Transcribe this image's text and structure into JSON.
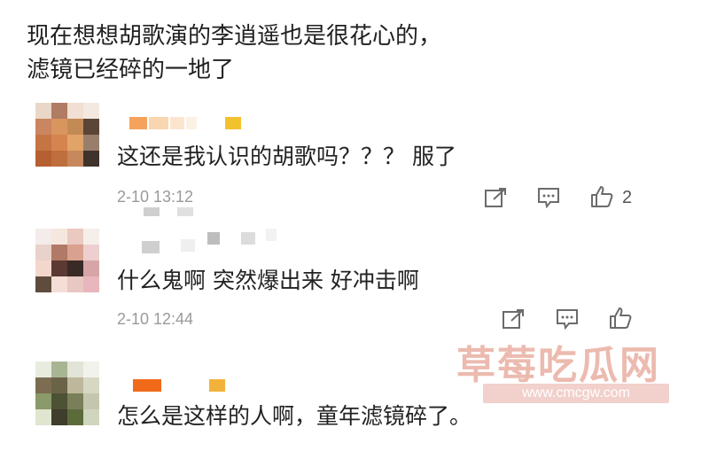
{
  "post": {
    "line1": "现在想想胡歌演的李逍遥也是很花心的，",
    "line2": "滤镜已经碎的一地了"
  },
  "comments": [
    {
      "text": "这还是我认识的胡歌吗？？？ 服了",
      "time": "2-10 13:12",
      "likes": "2"
    },
    {
      "text": "什么鬼啊 突然爆出来 好冲击啊",
      "time": "2-10 12:44",
      "likes": ""
    },
    {
      "text": "怎么是这样的人啊，童年滤镜碎了。",
      "time": "",
      "likes": ""
    }
  ],
  "icons": {
    "share": "share-icon",
    "reply": "comment-icon",
    "like": "thumbs-up-icon"
  },
  "watermark": {
    "title": "草莓吃瓜网",
    "url": "www.cmcgw.com"
  },
  "colors": {
    "text": "#222222",
    "meta": "#9a9a9a",
    "icon": "#6b6b6b",
    "name_orange": "#f5a35a",
    "name_yellow": "#f2c12e",
    "name_deep_orange": "#f06a1a"
  }
}
